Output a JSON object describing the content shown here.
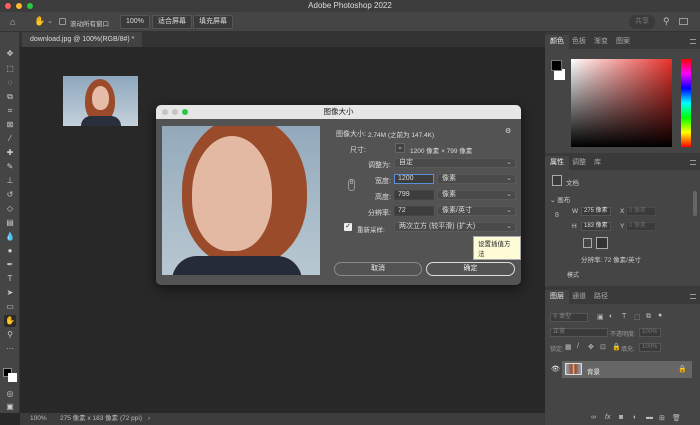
{
  "app": {
    "title": "Adobe Photoshop 2022"
  },
  "options_bar": {
    "scroll_all_label": "滚动所有窗口",
    "zoom_100": "100%",
    "fit_screen": "适合屏幕",
    "fill_screen": "填充屏幕",
    "share": "共享"
  },
  "document_tab": {
    "label": "download.jpg @ 100%(RGB/8#) *"
  },
  "status_bar": {
    "zoom": "100%",
    "info": "275 像素 x 183 像素 (72 ppi)",
    "arrow": "›"
  },
  "dialog": {
    "title": "图像大小",
    "image_size_label": "图像大小:",
    "image_size_value": "2.74M (之前为 147.4K)",
    "dimensions_label": "尺寸:",
    "dimensions_value": "1200 像素 × 799 像素",
    "fit_to_label": "调整为:",
    "fit_to_value": "自定",
    "width_label": "宽度:",
    "width_value": "1200",
    "width_unit": "像素",
    "height_label": "高度:",
    "height_value": "799",
    "height_unit": "像素",
    "resolution_label": "分辨率:",
    "resolution_value": "72",
    "resolution_unit": "像素/英寸",
    "resample_label": "重新采样:",
    "resample_checked": true,
    "resample_value": "两次立方 (较平滑) (扩大)",
    "tooltip": "设置插值方法",
    "cancel": "取消",
    "ok": "确定"
  },
  "color_panel": {
    "tabs": [
      "颜色",
      "色板",
      "渐变",
      "图案"
    ],
    "active_tab": 0,
    "hue_color": "#e8302a"
  },
  "properties_panel": {
    "tabs": [
      "属性",
      "调整",
      "库"
    ],
    "active_tab": 0,
    "doc_label": "文档",
    "canvas_label": "画布",
    "w_label": "W",
    "w_value": "275 像素",
    "h_label": "H",
    "h_value": "183 像素",
    "x_label": "X",
    "x_value": "0 像素",
    "y_label": "Y",
    "y_value": "0 像素",
    "resolution": "分辨率: 72 像素/英寸",
    "mode_label": "模式"
  },
  "layers_panel": {
    "tabs": [
      "图层",
      "通道",
      "路径"
    ],
    "active_tab": 0,
    "filter_placeholder": "类型",
    "blend_mode": "正常",
    "opacity_label": "不透明度:",
    "opacity_value": "100%",
    "lock_label": "锁定:",
    "fill_label": "填充:",
    "fill_value": "100%",
    "layers": [
      {
        "name": "背景",
        "visible": true,
        "locked": true
      }
    ]
  }
}
